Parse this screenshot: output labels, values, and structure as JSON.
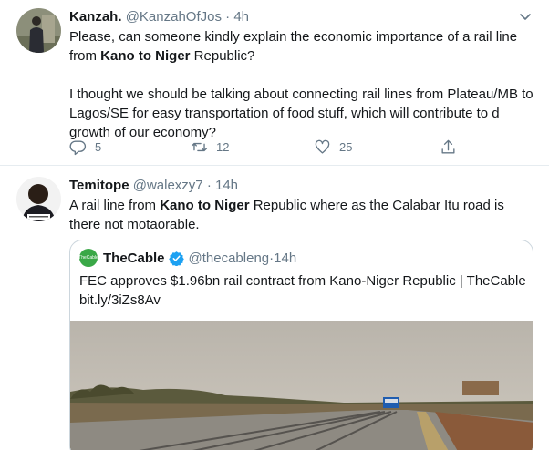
{
  "tweet1": {
    "name": "Kanzah.",
    "handle": "@KanzahOfJos",
    "separator": "·",
    "time": "4h",
    "text1_pre": "Please, can someone kindly explain the economic importance of a rail line from ",
    "text1_bold": "Kano to Niger",
    "text1_post": " Republic?",
    "text2": "I thought we should be talking about connecting rail lines from Plateau/MB to Lagos/SE for easy transportation of food stuff, which will contribute to d growth of our economy?",
    "reply_count": "5",
    "retweet_count": "12",
    "like_count": "25"
  },
  "tweet2": {
    "name": "Temitope",
    "handle": "@walexzy7",
    "separator": "·",
    "time": "14h",
    "text_pre": "A rail line from ",
    "text_bold": "Kano to Niger",
    "text_post": " Republic where as the Calabar Itu road is there not motaorable."
  },
  "quote": {
    "name": "TheCable",
    "handle": "@thecableng",
    "separator": "·",
    "time": "14h",
    "text": "FEC approves $1.96bn rail contract from Kano-Niger Republic | TheCable bit.ly/3iZs8Av",
    "logo_text": "TheCable"
  },
  "icons": {
    "reply": "reply-icon",
    "retweet": "retweet-icon",
    "like": "heart-icon",
    "share": "share-icon",
    "caret": "chevron-down-icon",
    "verified": "verified-badge-icon"
  },
  "colors": {
    "text": "#14171a",
    "secondary": "#657786",
    "border": "#e6ecf0",
    "verified": "#1da1f2",
    "cable_green": "#3aa847"
  }
}
